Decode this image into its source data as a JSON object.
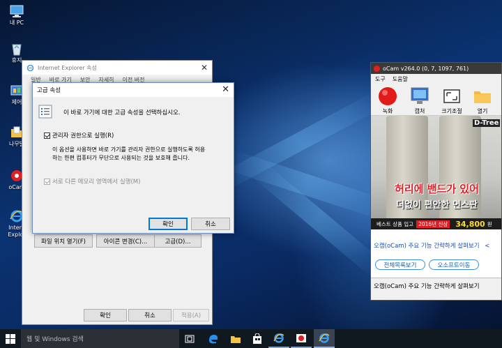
{
  "desktop": {
    "icons": [
      {
        "label": "내 PC",
        "icon": "computer-icon"
      },
      {
        "label": "휴지",
        "icon": "recycle-bin-icon"
      },
      {
        "label": "제어",
        "icon": "control-panel-icon"
      },
      {
        "label": "나무발",
        "icon": "folder-icon"
      },
      {
        "label": "oCam",
        "icon": "ocam-icon"
      },
      {
        "label": "Intern",
        "label2": "Explor",
        "icon": "internet-explorer-icon"
      }
    ]
  },
  "ie_props": {
    "title": "Internet Explorer 속성",
    "tabs": [
      "일반",
      "바로 가기",
      "보안",
      "자세히",
      "이전 버전"
    ],
    "buttons": {
      "open_location": "파일 위치 열기(F)",
      "change_icon": "아이콘 변경(C)...",
      "advanced": "고급(D)..."
    },
    "footer": {
      "ok": "확인",
      "cancel": "취소",
      "apply": "적용(A)"
    }
  },
  "advanced_dialog": {
    "title": "고급 속성",
    "intro": "이 바로 가기에 대한 고급 속성을 선택하십시오.",
    "run_as_admin": {
      "label": "관리자 권한으로 실행(R)",
      "checked": true
    },
    "description": "이 옵션을 사용하면 바로 가기를 관리자 권한으로 실행하도록 허용하는 한편 컴퓨터가 무단으로 사용되는 것을 보호해 줍니다.",
    "separate_memory": {
      "label": "서로 다른 메모리 영역에서 실행(M)",
      "checked": true,
      "disabled": true
    },
    "ok": "확인",
    "cancel": "취소"
  },
  "ocam": {
    "title": "oCam v264.0 (0, 7, 1097, 761)",
    "menu": [
      "도구",
      "도움말"
    ],
    "toolbar": [
      "녹화",
      "캡처",
      "크기조절",
      "열기"
    ],
    "ad": {
      "brand": "D-Tree",
      "headline1": "허리에 밴드가 있어",
      "headline2": "더없이 편안한 면스판",
      "bar_text": "베스트 상품 입고",
      "badge": "2016년 신상",
      "price": "34,800",
      "price_unit": "원"
    },
    "link1": "오캠(oCam) 주요 기능 간략하게 살펴보기",
    "link1_extra": "<",
    "pills": [
      "전체목록보기",
      "오소프트이동"
    ],
    "status": "오캠(oCam) 주요 기능 간략하게 살펴보기"
  },
  "taskbar": {
    "search_placeholder": "웹 및 Windows 검색",
    "items": [
      "task-view-icon",
      "edge-icon",
      "file-explorer-icon",
      "store-icon",
      "internet-explorer-icon",
      "ocam-taskbar-icon",
      "internet-explorer-active-icon"
    ]
  },
  "colors": {
    "accent": "#0078d7",
    "desktop": "#0b3372",
    "taskbar": "#101820",
    "ad_red": "#e31b23"
  }
}
